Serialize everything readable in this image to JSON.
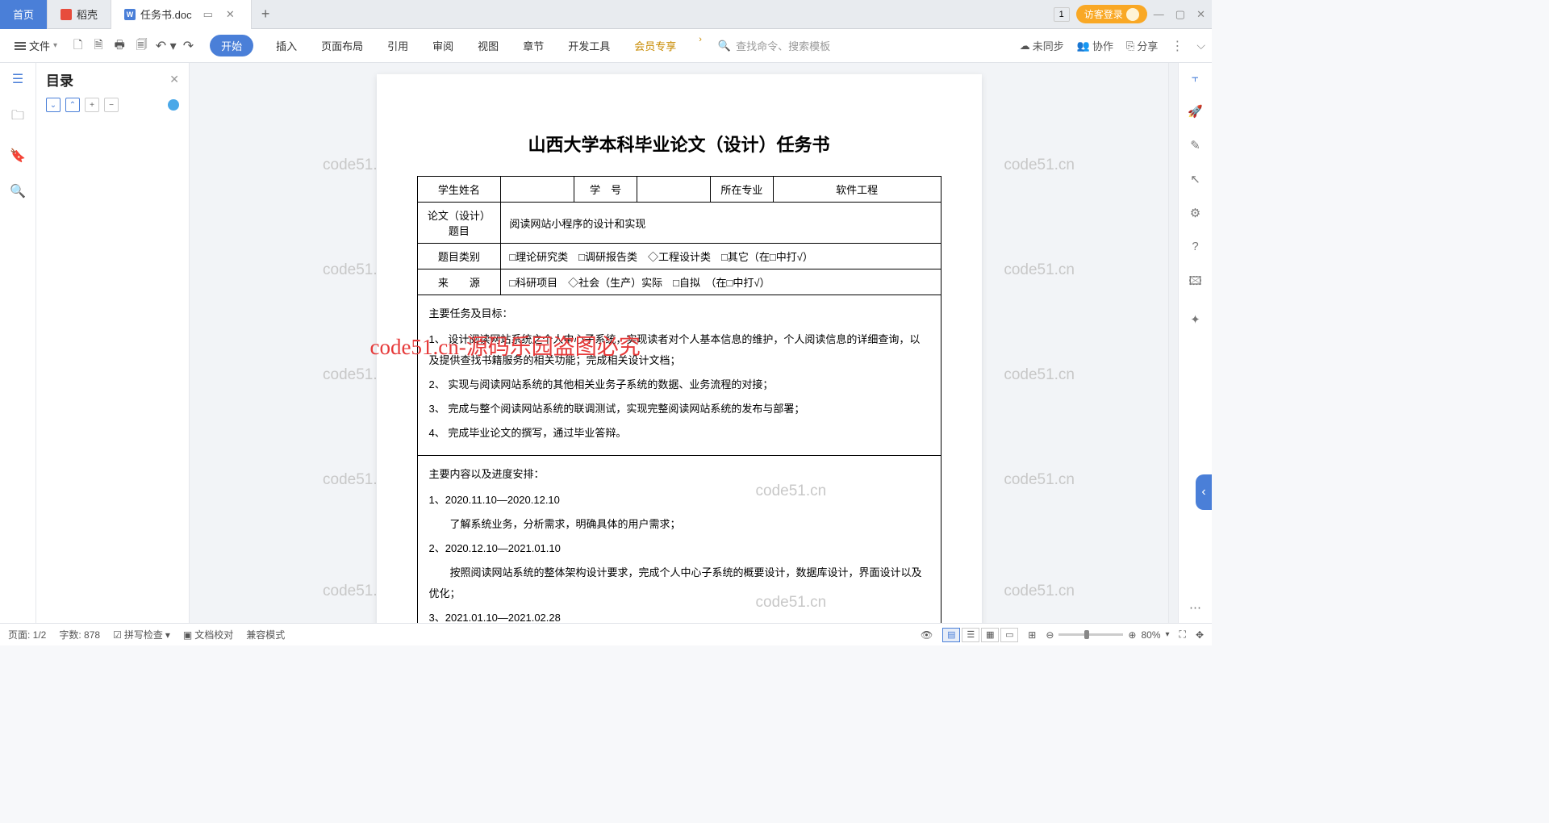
{
  "tabs": {
    "home": "首页",
    "daoke": "稻壳",
    "doc": "任务书.doc"
  },
  "topRight": {
    "box": "1",
    "login": "访客登录"
  },
  "ribbon": {
    "file": "文件",
    "tabs": [
      "开始",
      "插入",
      "页面布局",
      "引用",
      "审阅",
      "视图",
      "章节",
      "开发工具",
      "会员专享"
    ],
    "searchPlaceholder": "查找命令、搜索模板",
    "right": {
      "sync": "未同步",
      "coop": "协作",
      "share": "分享"
    }
  },
  "outline": {
    "title": "目录"
  },
  "doc": {
    "title": "山西大学本科毕业论文（设计）任务书",
    "row1": {
      "c1": "学生姓名",
      "c2": "",
      "c3": "学　号",
      "c4": "",
      "c5": "所在专业",
      "c6": "软件工程"
    },
    "row2": {
      "c1": "论文（设计）题目",
      "c2": "阅读网站小程序的设计和实现"
    },
    "row3": {
      "c1": "题目类别",
      "c2": "□理论研究类　□调研报告类　◇工程设计类　□其它（在□中打√）"
    },
    "row4": {
      "c1": "来　　源",
      "c2": "□科研项目　◇社会（生产）实际　□自拟　（在□中打√）"
    },
    "tasksHead": "主要任务及目标：",
    "tasks": [
      "1、 设计阅读网站系统之个人中心子系统，实现读者对个人基本信息的维护，个人阅读信息的详细查询，以及提供查找书籍服务的相关功能；完成相关设计文档；",
      "2、 实现与阅读网站系统的其他相关业务子系统的数据、业务流程的对接；",
      "3、 完成与整个阅读网站系统的联调测试，实现完整阅读网站系统的发布与部署；",
      "4、 完成毕业论文的撰写，通过毕业答辩。"
    ],
    "scheduleHead": "主要内容以及进度安排：",
    "schedule": [
      {
        "date": "1、2020.11.10—2020.12.10",
        "text": "了解系统业务，分析需求，明确具体的用户需求；"
      },
      {
        "date": "2、2020.12.10—2021.01.10",
        "text": "按照阅读网站系统的整体架构设计要求，完成个人中心子系统的概要设计，数据库设计，界面设计以及优化；"
      },
      {
        "date": "3、2021.01.10—2021.02.28",
        "text": ""
      }
    ]
  },
  "watermark": "code51.cn",
  "redWatermark": "code51.cn-源码乐园盗图必究",
  "status": {
    "page": "页面: 1/2",
    "words": "字数: 878",
    "spell": "拼写检查",
    "proof": "文档校对",
    "compat": "兼容模式",
    "zoom": "80%"
  }
}
